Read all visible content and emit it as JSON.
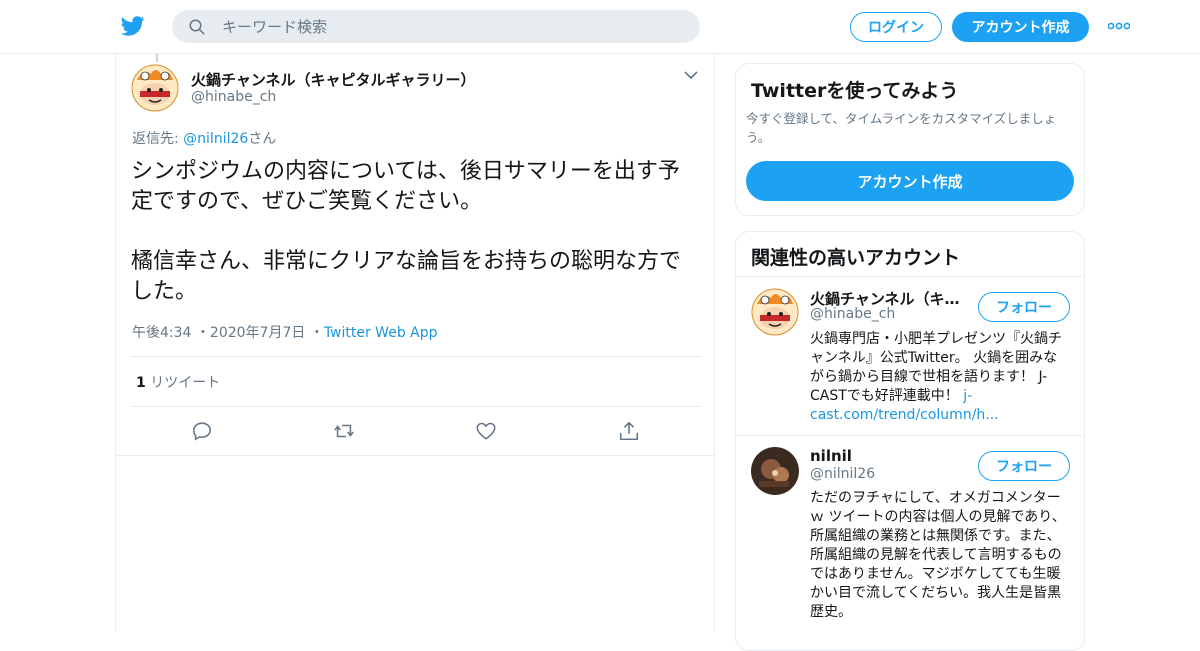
{
  "header": {
    "search_placeholder": "キーワード検索",
    "login_label": "ログイン",
    "signup_label": "アカウント作成"
  },
  "tweet": {
    "author_name": "火鍋チャンネル（キャピタルギャラリー）",
    "author_handle": "@hinabe_ch",
    "reply_prefix": "返信先: ",
    "reply_handle": "@nilnil26",
    "reply_suffix": "さん",
    "text": "シンポジウムの内容については、後日サマリーを出す予定ですので、ぜひご笑覧ください。\n\n橘信幸さん、非常にクリアな論旨をお持ちの聡明な方でした。",
    "time": "午後4:34",
    "date": "2020年7月7日",
    "source": "Twitter Web App",
    "retweet_count": "1",
    "retweet_label": "リツイート"
  },
  "sidebar": {
    "signup_card": {
      "title": "Twitterを使ってみよう",
      "subtitle": "今すぐ登録して、タイムラインをカスタマイズしましょう。",
      "button": "アカウント作成"
    },
    "related": {
      "title": "関連性の高いアカウント",
      "follow_label": "フォロー",
      "accounts": [
        {
          "name": "火鍋チャンネル（キ…",
          "handle": "@hinabe_ch",
          "bio": "火鍋専門店・小肥羊プレゼンツ『火鍋チャンネル』公式Twitter。 火鍋を囲みながら鍋から目線で世相を語ります！ J-CASTでも好評連載中！ ",
          "bio_link": "j-cast.com/trend/column/h..."
        },
        {
          "name": "nilnil",
          "handle": "@nilnil26",
          "bio": "ただのヲチャにして、オメガコメンターｗ ツイートの内容は個人の見解であり、所属組織の業務とは無関係です。また、所属組織の見解を代表して言明するものではありません。マジボケしてても生暖かい目で流してくだちい。我人生是皆黒歴史。"
        }
      ]
    }
  },
  "colors": {
    "accent": "#1da1f2",
    "link": "#1b95e0",
    "muted": "#657786",
    "border": "#e6ecf0"
  },
  "icons": [
    "twitter-bird-icon",
    "search-icon",
    "more-icon",
    "chevron-down-icon",
    "reply-icon",
    "retweet-icon",
    "like-icon",
    "share-icon"
  ]
}
